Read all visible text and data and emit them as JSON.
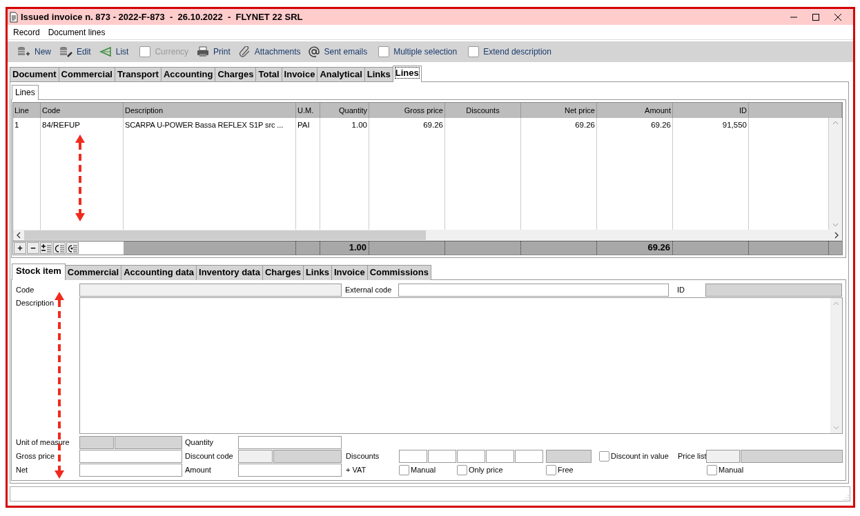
{
  "window": {
    "title": "Issued invoice n. 873 - 2022-F-873  -  26.10.2022  -  FLYNET 22 SRL"
  },
  "menu": [
    "Record",
    "Document lines"
  ],
  "toolbar": [
    {
      "kind": "button",
      "label": "New",
      "disabled": false
    },
    {
      "kind": "button",
      "label": "Edit",
      "disabled": false
    },
    {
      "kind": "button",
      "label": "List",
      "disabled": false
    },
    {
      "kind": "checkbox",
      "label": "Currency",
      "checked": false,
      "disabled": true
    },
    {
      "kind": "button",
      "label": "Print",
      "disabled": false
    },
    {
      "kind": "button",
      "label": "Attachments",
      "disabled": false
    },
    {
      "kind": "button",
      "label": "Sent emails",
      "disabled": false
    },
    {
      "kind": "checkbox",
      "label": "Multiple selection",
      "checked": false,
      "disabled": false
    },
    {
      "kind": "checkbox",
      "label": "Extend description",
      "checked": false,
      "disabled": false
    }
  ],
  "tabs": [
    {
      "label": "Document",
      "selected": false
    },
    {
      "label": "Commercial",
      "selected": false
    },
    {
      "label": "Transport",
      "selected": false
    },
    {
      "label": "Accounting",
      "selected": false
    },
    {
      "label": "Charges",
      "selected": false
    },
    {
      "label": "Total",
      "selected": false
    },
    {
      "label": "Invoice",
      "selected": false
    },
    {
      "label": "Analytical",
      "selected": false
    },
    {
      "label": "Links",
      "selected": false
    },
    {
      "label": "Lines",
      "selected": true
    }
  ],
  "subtabs": [
    {
      "label": "Lines",
      "selected": true
    }
  ],
  "grid": {
    "columns": [
      "Line",
      "Code",
      "Description",
      "U.M.",
      "Quantity",
      "Gross price",
      "Discounts",
      "Net price",
      "Amount",
      "ID"
    ],
    "rows": [
      {
        "cells": [
          "1",
          "84/REFUP",
          "SCARPA U-POWER Bassa REFLEX S1P src ...",
          "PAI",
          "1.00",
          "69.26",
          "",
          "69.26",
          "69.26",
          "91,550"
        ]
      }
    ],
    "footer_buttons": [
      "+",
      "−"
    ],
    "totals": {
      "quantity": "1.00",
      "amount": "69.26"
    }
  },
  "detail_tabs": [
    {
      "label": "Stock item",
      "selected": true
    },
    {
      "label": "Commercial",
      "selected": false
    },
    {
      "label": "Accounting data",
      "selected": false
    },
    {
      "label": "Inventory data",
      "selected": false
    },
    {
      "label": "Charges",
      "selected": false
    },
    {
      "label": "Links",
      "selected": false
    },
    {
      "label": "Invoice",
      "selected": false
    },
    {
      "label": "Commissions",
      "selected": false
    }
  ],
  "form": {
    "labels": {
      "code": "Code",
      "external_code": "External code",
      "id": "ID",
      "description": "Description",
      "unit": "Unit of measure",
      "quantity": "Quantity",
      "gross_price": "Gross price",
      "discount_code": "Discount code",
      "discounts": "Discounts",
      "price_list": "Price list",
      "net": "Net",
      "amount": "Amount",
      "vat": "+ VAT"
    },
    "fields": {
      "code": {
        "disabled": true
      },
      "external_code": {
        "disabled": false
      },
      "id": {
        "disabled": true
      },
      "description": {
        "disabled": false
      },
      "unit": {
        "disabled": true
      },
      "unit_name": {
        "disabled": true
      },
      "quantity": {
        "disabled": false
      },
      "gross_price": {
        "disabled": false
      },
      "discount_code": {
        "disabled": true
      },
      "discount_code_name": {
        "disabled": true
      },
      "discount_1": {
        "disabled": false
      },
      "discount_2": {
        "disabled": false
      },
      "discount_3": {
        "disabled": false
      },
      "discount_4": {
        "disabled": false
      },
      "discount_5": {
        "disabled": false
      },
      "discount_total": {
        "disabled": true
      },
      "price_list": {
        "disabled": true
      },
      "price_list_name": {
        "disabled": true
      },
      "net": {
        "disabled": false
      },
      "amount": {
        "disabled": false
      }
    },
    "checkboxes": [
      {
        "label": "Discount in value",
        "checked": false
      },
      {
        "label": "Manual",
        "checked": false
      },
      {
        "label": "Only price",
        "checked": false
      },
      {
        "label": "Free",
        "checked": false
      },
      {
        "label": "Manual",
        "checked": false
      }
    ]
  }
}
